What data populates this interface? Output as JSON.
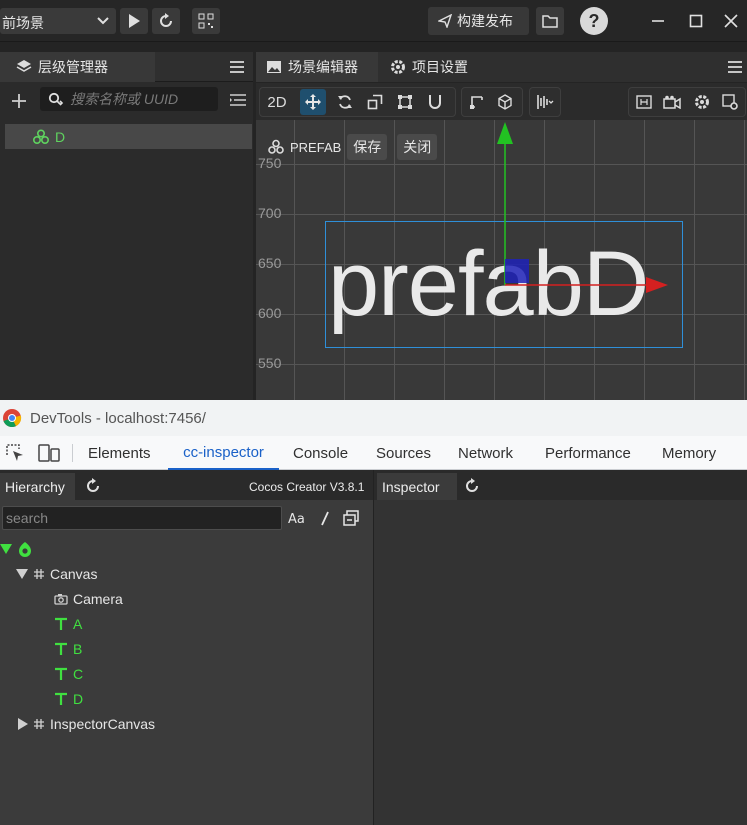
{
  "editor": {
    "scene_select": "前场景",
    "publish_label": "构建发布",
    "help_label": "?",
    "hierarchy": {
      "tab_label": "层级管理器",
      "search_placeholder": "搜索名称或 UUID",
      "node": "D"
    },
    "scene_tabs": [
      "场景编辑器",
      "项目设置"
    ],
    "toolbar": {
      "mode_2d": "2D"
    },
    "prefab": {
      "label": "PREFAB",
      "save": "保存",
      "close": "关闭"
    },
    "viewport": {
      "y_labels": [
        "750",
        "700",
        "650",
        "600",
        "550"
      ],
      "text": "prefabD"
    }
  },
  "devtools": {
    "title": "DevTools - localhost:7456/",
    "tabs": [
      "Elements",
      "cc-inspector",
      "Console",
      "Sources",
      "Network",
      "Performance",
      "Memory"
    ],
    "active_tab": "cc-inspector"
  },
  "cc_inspector": {
    "hierarchy_tab": "Hierarchy",
    "version": "Cocos Creator V3.8.1",
    "inspector_tab": "Inspector",
    "search_placeholder": "search",
    "tree": {
      "canvas": "Canvas",
      "camera": "Camera",
      "labels": [
        "A",
        "B",
        "C",
        "D"
      ],
      "inspector_canvas": "InspectorCanvas"
    }
  },
  "colors": {
    "accent_green": "#40e040",
    "devtools_active": "#1a61c8",
    "selection_blue": "#2f8fd8"
  }
}
